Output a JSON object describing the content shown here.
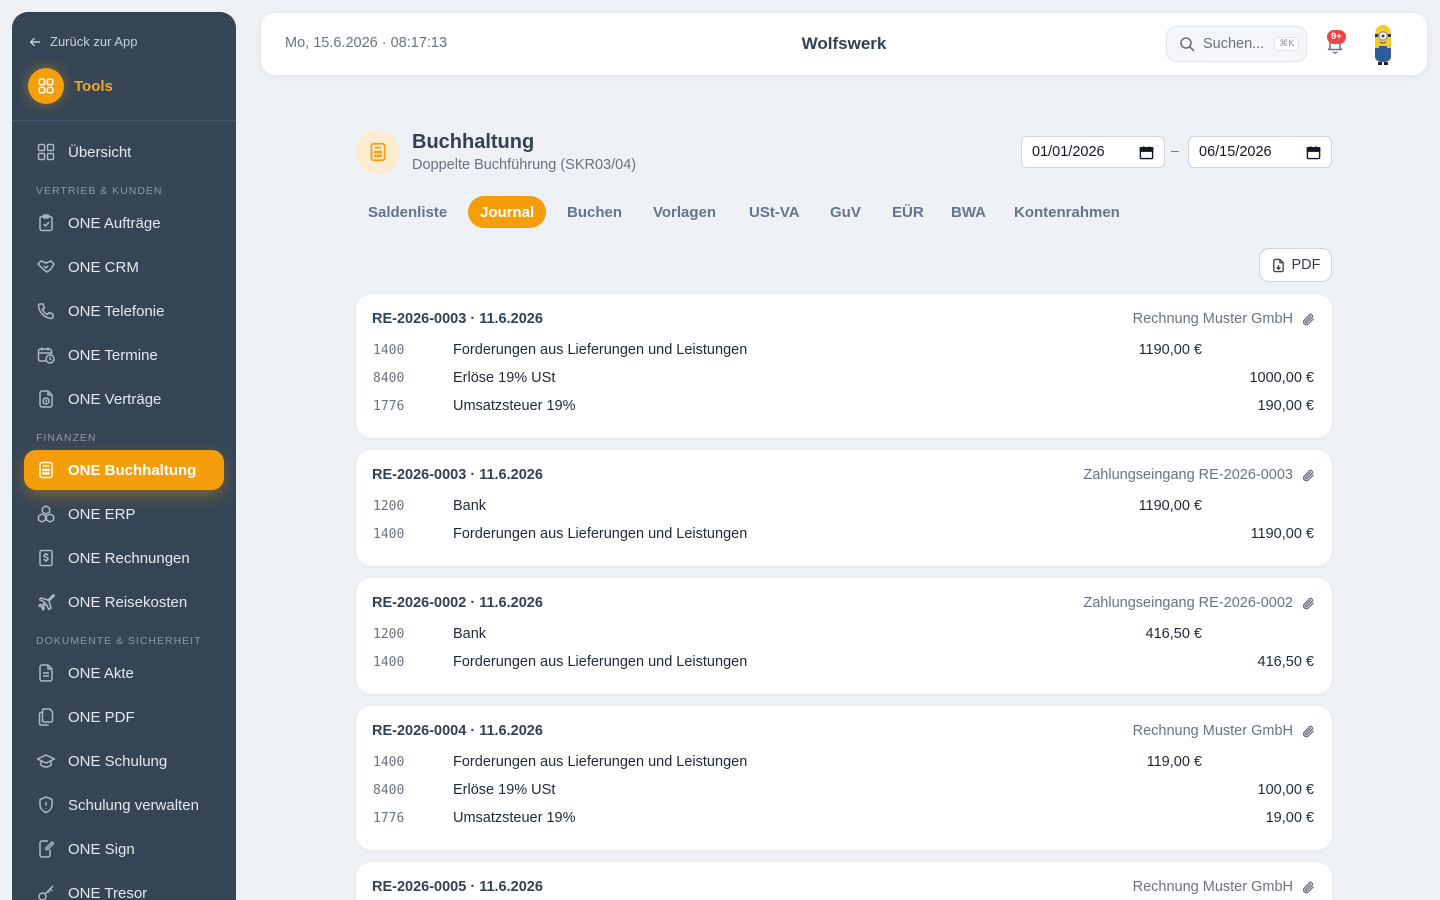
{
  "sidebar": {
    "back_label": "Zurück zur App",
    "tools_label": "Tools",
    "overview": "Übersicht",
    "sections": {
      "sales": "VERTRIEB & KUNDEN",
      "finance": "FINANZEN",
      "docs": "DOKUMENTE & SICHERHEIT"
    },
    "items": {
      "auftraege": "ONE Aufträge",
      "crm": "ONE CRM",
      "telefonie": "ONE Telefonie",
      "termine": "ONE Termine",
      "vertraege": "ONE Verträge",
      "buchhaltung": "ONE Buchhaltung",
      "erp": "ONE ERP",
      "rechnungen": "ONE Rechnungen",
      "reisekosten": "ONE Reisekosten",
      "akte": "ONE Akte",
      "pdf": "ONE PDF",
      "schulung": "ONE Schulung",
      "schulung_verwalten": "Schulung verwalten",
      "sign": "ONE Sign",
      "tresor": "ONE Tresor"
    },
    "active_color": "#f59e0b"
  },
  "header": {
    "datetime": "Mo, 15.6.2026 · 08:17:13",
    "brand": "Wolfswerk",
    "search_placeholder": "Suchen...",
    "search_shortcut": "⌘K",
    "notification_badge": "9+"
  },
  "page": {
    "title": "Buchhaltung",
    "subtitle": "Doppelte Buchführung (SKR03/04)",
    "date_from": "01/01/2026",
    "date_sep": "–",
    "date_to": "06/15/2026",
    "pdf_label": "PDF"
  },
  "tabs": {
    "saldenliste": "Saldenliste",
    "journal": "Journal",
    "buchen": "Buchen",
    "vorlagen": "Vorlagen",
    "ustva": "USt-VA",
    "guv": "GuV",
    "eur": "EÜR",
    "bwa": "BWA",
    "kontenrahmen": "Kontenrahmen"
  },
  "journal": [
    {
      "head": "RE-2026-0003 · 11.6.2026",
      "desc": "Rechnung Muster GmbH",
      "lines": [
        {
          "acct": "1400",
          "name": "Forderungen aus Lieferungen und Leistungen",
          "debit": "1190,00 €",
          "credit": ""
        },
        {
          "acct": "8400",
          "name": "Erlöse 19% USt",
          "debit": "",
          "credit": "1000,00 €"
        },
        {
          "acct": "1776",
          "name": "Umsatzsteuer 19%",
          "debit": "",
          "credit": "190,00 €"
        }
      ]
    },
    {
      "head": "RE-2026-0003 · 11.6.2026",
      "desc": "Zahlungseingang RE-2026-0003",
      "lines": [
        {
          "acct": "1200",
          "name": "Bank",
          "debit": "1190,00 €",
          "credit": ""
        },
        {
          "acct": "1400",
          "name": "Forderungen aus Lieferungen und Leistungen",
          "debit": "",
          "credit": "1190,00 €"
        }
      ]
    },
    {
      "head": "RE-2026-0002 · 11.6.2026",
      "desc": "Zahlungseingang RE-2026-0002",
      "lines": [
        {
          "acct": "1200",
          "name": "Bank",
          "debit": "416,50 €",
          "credit": ""
        },
        {
          "acct": "1400",
          "name": "Forderungen aus Lieferungen und Leistungen",
          "debit": "",
          "credit": "416,50 €"
        }
      ]
    },
    {
      "head": "RE-2026-0004 · 11.6.2026",
      "desc": "Rechnung Muster GmbH",
      "lines": [
        {
          "acct": "1400",
          "name": "Forderungen aus Lieferungen und Leistungen",
          "debit": "119,00 €",
          "credit": ""
        },
        {
          "acct": "8400",
          "name": "Erlöse 19% USt",
          "debit": "",
          "credit": "100,00 €"
        },
        {
          "acct": "1776",
          "name": "Umsatzsteuer 19%",
          "debit": "",
          "credit": "19,00 €"
        }
      ]
    },
    {
      "head": "RE-2026-0005 · 11.6.2026",
      "desc": "Rechnung Muster GmbH",
      "lines": []
    }
  ]
}
